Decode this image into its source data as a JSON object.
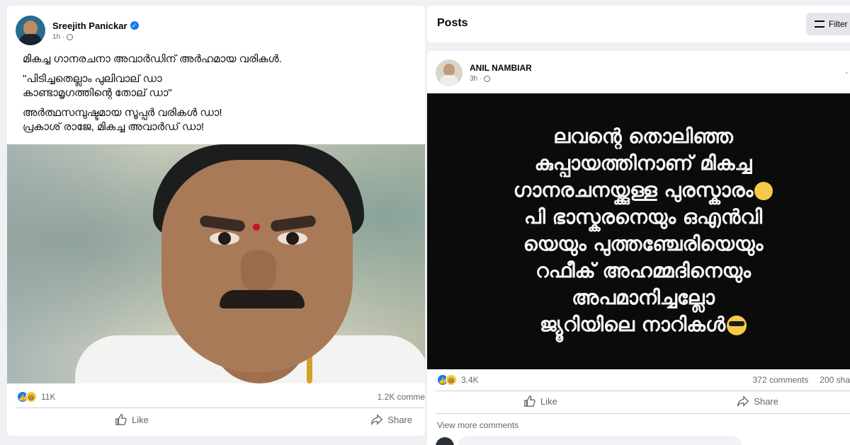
{
  "left_post": {
    "author": "Sreejith Panickar",
    "time": "1h",
    "text_lines": [
      "മികച്ച ഗാനരചനാ അവാർഡിന് അർഹമായ വരികൾ.",
      "\"പിടിച്ചതെല്ലാം പുലിവാല് ഡാ",
      "കാണ്ടാമൃഗത്തിന്റെ തോല് ഡാ\"",
      "അർത്ഥസമ്പുഷ്ടമായ സൂപ്പർ വരികൾ ഡാ!",
      "പ്രകാശ് രാജേ, മികച്ച അവാർഡ് ഡാ!"
    ],
    "reactions_count": "11K",
    "comments_count": "1.2K comme",
    "like_label": "Like",
    "share_label": "Share"
  },
  "posts_header": {
    "title": "Posts",
    "filter_label": "Filter"
  },
  "right_post": {
    "author": "ANIL NAMBIAR",
    "time": "3h",
    "more_label": "·",
    "image_lines": [
      "ലവന്റെ തൊലിഞ്ഞ",
      "കുപ്പായത്തിനാണ് മികച്ച",
      "ഗാനരചനയ്ക്കുള്ള പുരസ്കാരം",
      "പി ഭാസ്കരനെയും ഒഎൻവി",
      "യെയും പുത്തഞ്ചേരിയെയും",
      "റഫീക് അഹമ്മദിനെയും",
      "അപമാനിച്ചല്ലോ",
      "ജ്യൂറിയിലെ നാറികൾ"
    ],
    "reactions_count": "3.4K",
    "comments_count": "372 comments",
    "shares_count": "200 sha",
    "like_label": "Like",
    "share_label": "Share",
    "view_more": "View more comments"
  },
  "colors": {
    "facebook_blue": "#1877f2",
    "secondary_text": "#65676b",
    "image_bg": "#0b0b0c"
  }
}
